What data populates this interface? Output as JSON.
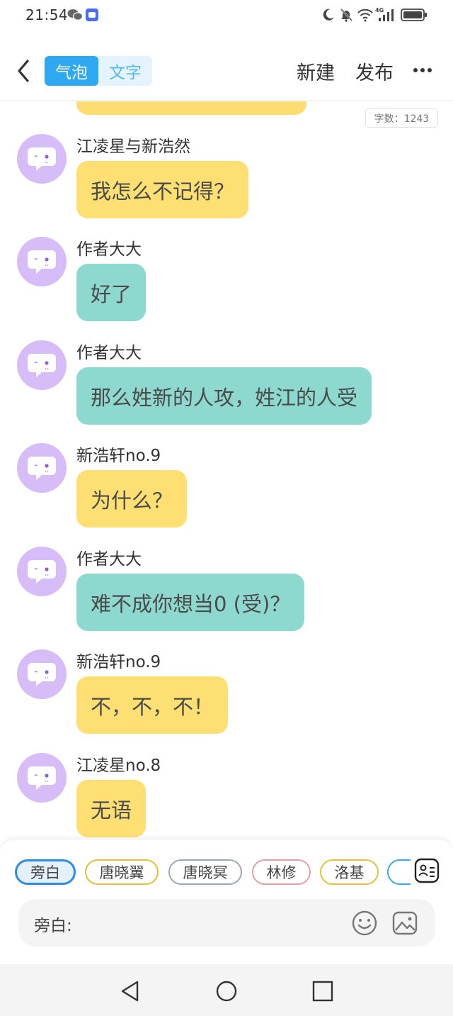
{
  "status_bar": {
    "time": "21:54",
    "network": "4G"
  },
  "header": {
    "mode_bubble": "气泡",
    "mode_text": "文字",
    "new_label": "新建",
    "publish_label": "发布"
  },
  "chat": {
    "word_count": "字数：1243",
    "messages": [
      {
        "sender": "江凌星与新浩然",
        "text": "我怎么不记得？",
        "color": "yellow"
      },
      {
        "sender": "作者大大",
        "text": "好了",
        "color": "teal"
      },
      {
        "sender": "作者大大",
        "text": "那么姓新的人攻，姓江的人受",
        "color": "teal"
      },
      {
        "sender": "新浩轩no.9",
        "text": "为什么？",
        "color": "yellow"
      },
      {
        "sender": "作者大大",
        "text": "难不成你想当0 (受)？",
        "color": "teal"
      },
      {
        "sender": "新浩轩no.9",
        "text": "不，不，不！",
        "color": "yellow"
      },
      {
        "sender": "江凌星no.8",
        "text": "无语",
        "color": "yellow"
      }
    ]
  },
  "roles": {
    "chips": [
      {
        "label": "旁白",
        "border": "#2d8ae6"
      },
      {
        "label": "唐晓翼",
        "border": "#e0c23a"
      },
      {
        "label": "唐晓冥",
        "border": "#9aa9b8"
      },
      {
        "label": "林修",
        "border": "#e2a0a0"
      },
      {
        "label": "洛基",
        "border": "#e0c23a"
      }
    ]
  },
  "input": {
    "label": "旁白:",
    "placeholder": ""
  },
  "colors": {
    "accent": "#2da8f1",
    "yellow_bubble": "#fedf73",
    "teal_bubble": "#8ed9cf",
    "avatar": "#d6bdf7"
  },
  "icons": {
    "back": "chevron-left-icon",
    "more": "more-horizontal-icon",
    "role_card": "id-card-icon",
    "emoji": "smile-icon",
    "image": "image-icon",
    "nav_back": "triangle-back-icon",
    "nav_home": "circle-home-icon",
    "nav_recent": "square-recent-icon"
  }
}
